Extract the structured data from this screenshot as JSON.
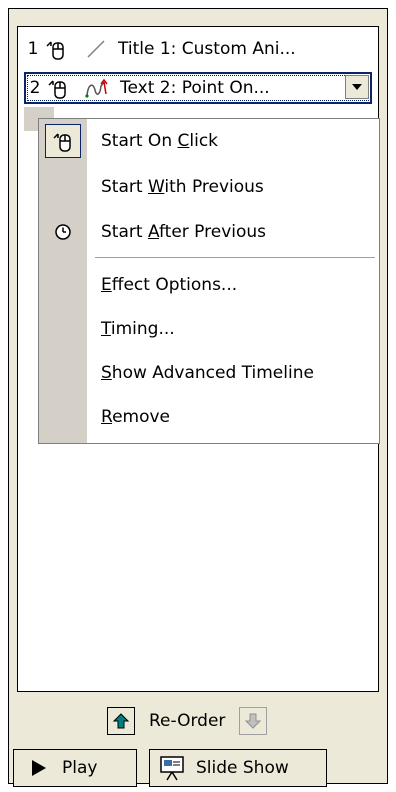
{
  "list": {
    "items": [
      {
        "number": "1",
        "label": "Title 1: Custom Ani..."
      },
      {
        "number": "2",
        "label": "Text 2: Point On..."
      }
    ]
  },
  "menu": {
    "start_on_click": {
      "pre": "Start On ",
      "key": "C",
      "post": "lick"
    },
    "start_with_previous": {
      "pre": "Start ",
      "key": "W",
      "post": "ith Previous"
    },
    "start_after_previous": {
      "pre": "Start ",
      "key": "A",
      "post": "fter Previous"
    },
    "effect_options": {
      "pre": "",
      "key": "E",
      "post": "ffect Options..."
    },
    "timing": {
      "pre": "",
      "key": "T",
      "post": "iming..."
    },
    "show_advanced_timeline": {
      "pre": "",
      "key": "S",
      "post": "how Advanced Timeline"
    },
    "remove": {
      "pre": "",
      "key": "R",
      "post": "emove"
    }
  },
  "reorder": {
    "label": "Re-Order"
  },
  "buttons": {
    "play": "Play",
    "slide_show": "Slide Show"
  },
  "colors": {
    "highlight": "#0a246a",
    "accent_arrow": "#008080",
    "path_red": "#cc0000",
    "path_green": "#008000"
  }
}
